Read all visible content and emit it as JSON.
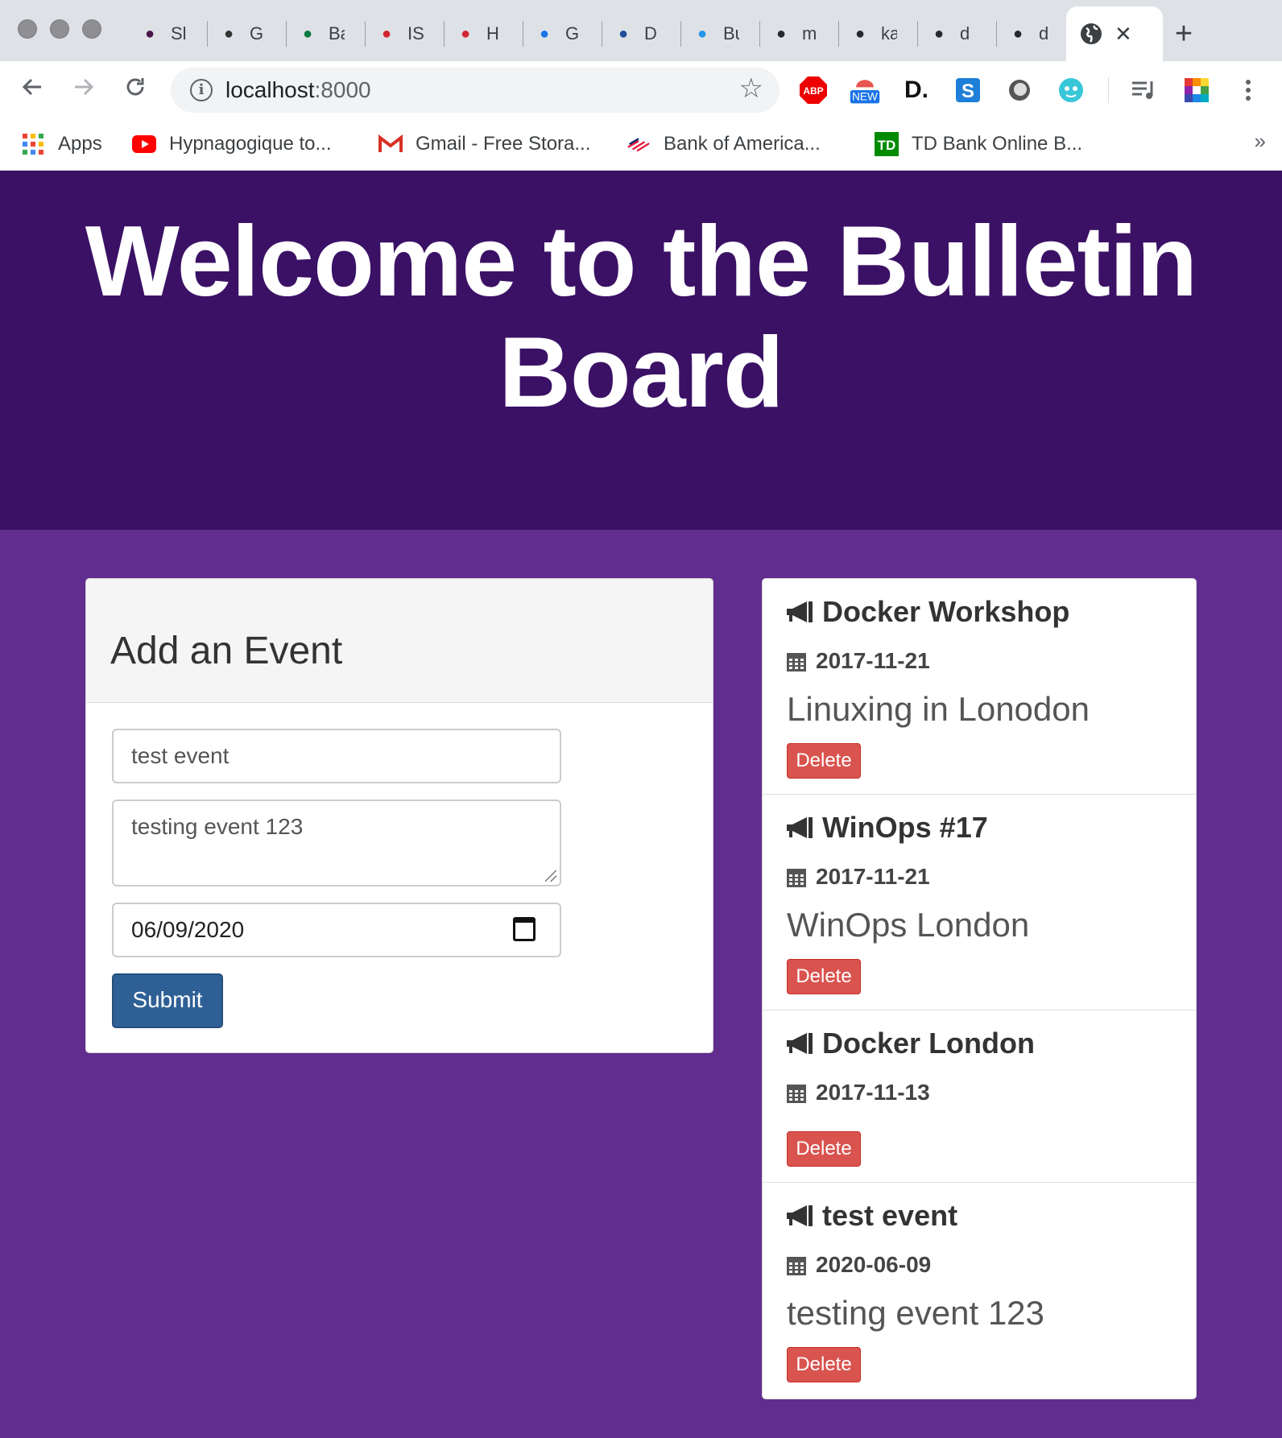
{
  "browser": {
    "tabs": [
      {
        "label": "Sl",
        "icon": "slack-icon",
        "color": "#4a154b"
      },
      {
        "label": "G",
        "icon": "markdown-icon",
        "color": "#333333"
      },
      {
        "label": "Ba",
        "icon": "cs-icon",
        "color": "#0a7a3e"
      },
      {
        "label": "IS",
        "icon": "njit-icon",
        "color": "#d22630"
      },
      {
        "label": "H",
        "icon": "njit-icon",
        "color": "#d22630"
      },
      {
        "label": "G",
        "icon": "info-icon",
        "color": "#1a73e8"
      },
      {
        "label": "D",
        "icon": "e-icon",
        "color": "#1f4e9a"
      },
      {
        "label": "Bu",
        "icon": "docker-icon",
        "color": "#2496ed"
      },
      {
        "label": "m",
        "icon": "github-icon",
        "color": "#24292e"
      },
      {
        "label": "ka",
        "icon": "github-icon",
        "color": "#24292e"
      },
      {
        "label": "d",
        "icon": "github-icon",
        "color": "#24292e"
      },
      {
        "label": "d",
        "icon": "github-icon",
        "color": "#24292e"
      }
    ],
    "active_tab": {
      "icon": "globe-icon",
      "close": "✕"
    },
    "new_tab": "+",
    "address": {
      "host": "localhost",
      "port": ":8000"
    },
    "extensions": [
      "ABP",
      "NEW",
      "D.",
      "S"
    ],
    "bookmarks": [
      {
        "label": "Apps",
        "icon": "apps-grid-icon"
      },
      {
        "label": "Hypnagogique to...",
        "icon": "youtube-icon"
      },
      {
        "label": "Gmail - Free Stora...",
        "icon": "gmail-icon"
      },
      {
        "label": "Bank of America...",
        "icon": "bofa-icon"
      },
      {
        "label": "TD Bank Online B...",
        "icon": "td-icon"
      }
    ],
    "bookmarks_more": "»"
  },
  "page": {
    "hero_title": "Welcome to the Bulletin Board",
    "form": {
      "heading": "Add an Event",
      "name_value": "test event",
      "description_value": "testing event 123",
      "date_value": "06/09/2020",
      "submit_label": "Submit"
    },
    "events": [
      {
        "title": "Docker Workshop",
        "date": "2017-11-21",
        "description": "Linuxing in Lonodon",
        "delete_label": "Delete"
      },
      {
        "title": "WinOps #17",
        "date": "2017-11-21",
        "description": "WinOps London",
        "delete_label": "Delete"
      },
      {
        "title": "Docker London",
        "date": "2017-11-13",
        "description": "",
        "delete_label": "Delete"
      },
      {
        "title": "test event",
        "date": "2020-06-09",
        "description": "testing event 123",
        "delete_label": "Delete"
      }
    ]
  },
  "colors": {
    "hero_bg": "#3b1165",
    "page_bg": "#612d8f",
    "submit_bg": "#2e6096",
    "delete_bg": "#d9534f"
  }
}
